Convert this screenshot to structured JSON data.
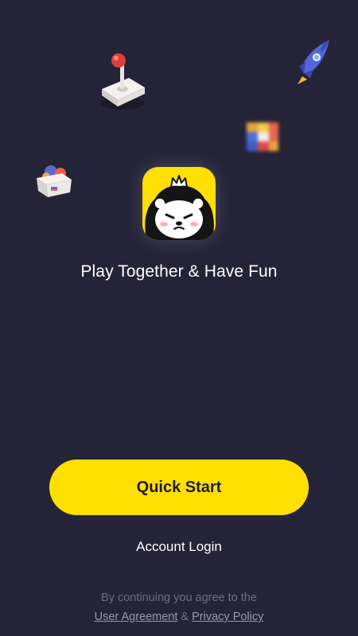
{
  "app": {
    "tagline": "Play Together & Have Fun",
    "logo_icon": "bear-mascot-with-crown-icon"
  },
  "decorations": [
    "joystick-icon",
    "rocket-icon",
    "rubiks-cube-icon",
    "toy-box-icon"
  ],
  "actions": {
    "quick_start_label": "Quick Start",
    "account_login_label": "Account Login"
  },
  "legal": {
    "prefix": "By continuing you agree to the",
    "user_agreement": "User Agreement",
    "separator": "&",
    "privacy_policy": "Privacy Policy"
  },
  "colors": {
    "background": "#252337",
    "accent": "#ffe000",
    "button_text": "#1f1d2e",
    "muted_text": "#6f6d85"
  }
}
